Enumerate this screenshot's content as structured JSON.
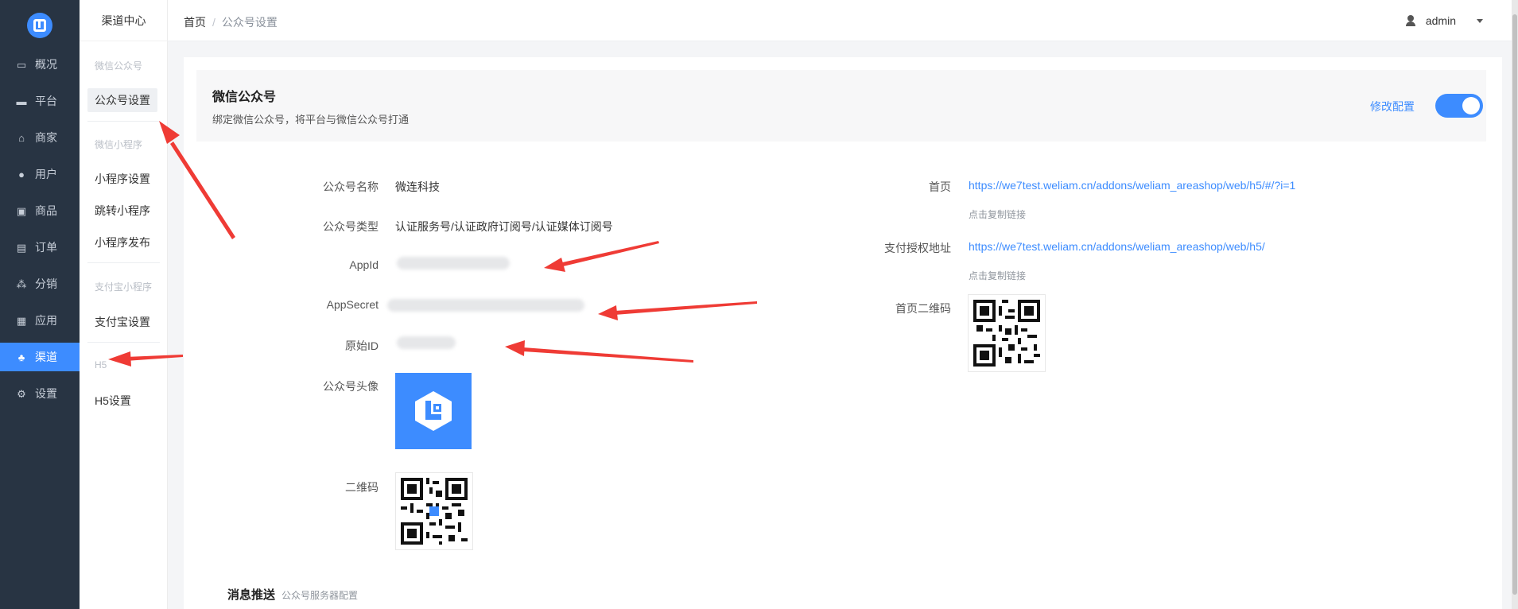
{
  "sidebar": {
    "items": [
      {
        "label": "概况",
        "icon": "monitor-icon"
      },
      {
        "label": "平台",
        "icon": "platform-icon"
      },
      {
        "label": "商家",
        "icon": "store-icon"
      },
      {
        "label": "用户",
        "icon": "user-icon"
      },
      {
        "label": "商品",
        "icon": "goods-icon"
      },
      {
        "label": "订单",
        "icon": "order-icon"
      },
      {
        "label": "分销",
        "icon": "distribution-icon"
      },
      {
        "label": "应用",
        "icon": "apps-icon"
      },
      {
        "label": "渠道",
        "icon": "channel-icon"
      },
      {
        "label": "设置",
        "icon": "gear-icon"
      }
    ],
    "active": "渠道"
  },
  "submenu": {
    "title": "渠道中心",
    "groups": [
      {
        "title": "微信公众号",
        "items": [
          "公众号设置"
        ]
      },
      {
        "title": "微信小程序",
        "items": [
          "小程序设置",
          "跳转小程序",
          "小程序发布"
        ]
      },
      {
        "title": "支付宝小程序",
        "items": [
          "支付宝设置"
        ]
      },
      {
        "title": "H5",
        "items": [
          "H5设置"
        ]
      }
    ],
    "active": "公众号设置"
  },
  "header": {
    "breadcrumb": [
      "首页",
      "公众号设置"
    ],
    "separator": "/",
    "user": "admin"
  },
  "banner": {
    "title": "微信公众号",
    "subtitle": "绑定微信公众号，将平台与微信公众号打通",
    "edit_link": "修改配置",
    "enabled": true
  },
  "form_left": {
    "name_label": "公众号名称",
    "name_value": "微连科技",
    "type_label": "公众号类型",
    "type_value": "认证服务号/认证政府订阅号/认证媒体订阅号",
    "appid_label": "AppId",
    "appsecret_label": "AppSecret",
    "origin_label": "原始ID",
    "avatar_label": "公众号头像",
    "qrcode_label": "二维码"
  },
  "form_right": {
    "home_label": "首页",
    "home_url": "https://we7test.weliam.cn/addons/weliam_areashop/web/h5/#/?i=1",
    "home_copy": "点击复制链接",
    "pay_label": "支付授权地址",
    "pay_url": "https://we7test.weliam.cn/addons/weliam_areashop/web/h5/",
    "pay_copy": "点击复制链接",
    "home_qr_label": "首页二维码"
  },
  "message_section": {
    "title": "消息推送",
    "subtitle": "公众号服务器配置"
  },
  "colors": {
    "accent": "#3d8cff",
    "sidebar": "#283443",
    "annotation_arrow": "#ef3b35"
  }
}
